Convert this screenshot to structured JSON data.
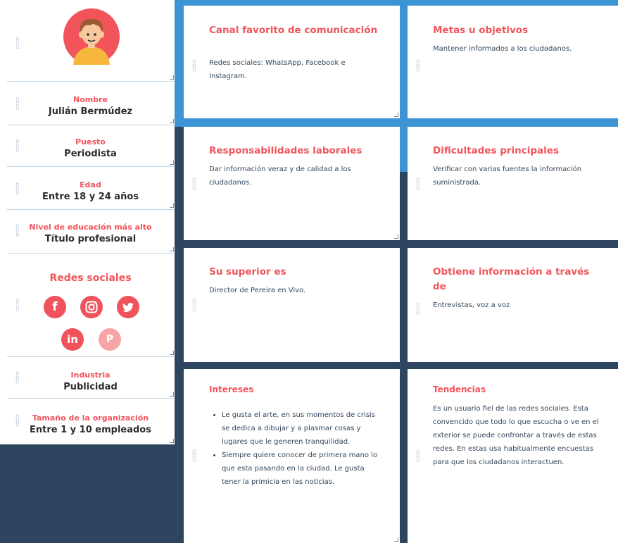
{
  "profile": {
    "avatar_label": "avatar",
    "fields": [
      {
        "label": "Nombre",
        "value": "Julián Bermúdez"
      },
      {
        "label": "Puesto",
        "value": "Periodista"
      },
      {
        "label": "Edad",
        "value": "Entre 18 y 24 años"
      },
      {
        "label": "Nivel de educación más alto",
        "value": "Título profesional"
      }
    ],
    "social": {
      "label": "Redes sociales",
      "icons": [
        "facebook-icon",
        "instagram-icon",
        "twitter-icon",
        "linkedin-icon",
        "pinterest-icon"
      ]
    },
    "fields2": [
      {
        "label": "Industria",
        "value": "Publicidad"
      },
      {
        "label": "Tamaño de la organización",
        "value": "Entre 1 y 10 empleados"
      }
    ]
  },
  "cards": {
    "canal": {
      "title": "Canal favorito de comunicación",
      "body": "Redes sociales: WhatsApp, Facebook e Instagram."
    },
    "metas": {
      "title": "Metas u objetivos",
      "body": "Mantener informados a los ciudadanos."
    },
    "responsabilidades": {
      "title": "Responsabilidades laborales",
      "body": "Dar información veraz y de calidad a los ciudadanos."
    },
    "dificultades": {
      "title": "Dificultades principales",
      "body": "Verificar con varias fuentes la información suministrada."
    },
    "superior": {
      "title": "Su superior es",
      "body": "Director de Pereira en Vivo."
    },
    "obtiene": {
      "title": "Obtiene información a través de",
      "body": "Entrevistas, voz a voz"
    },
    "intereses": {
      "title": "Intereses",
      "items": [
        "Le gusta el arte, en sus momentos de crisis se dedica a dibujar y a plasmar cosas y lugares que le generen tranquilidad.",
        "Siempre quiere conocer de primera mano lo que esta pasando en la ciudad. Le gusta tener la primicia en las noticias."
      ]
    },
    "tendencias": {
      "title": "Tendencias",
      "body": "Es un usuario fiel de las redes sociales. Esta convencido que todo lo que escucha o ve en el exterior se puede confrontar a través de estas redes. En estas usa habitualmente encuestas para que los ciudadanos interactuen."
    }
  },
  "colors": {
    "accent": "#f2545b",
    "dark": "#2e4560",
    "blue": "#3c94d4",
    "text": "#33475b"
  }
}
